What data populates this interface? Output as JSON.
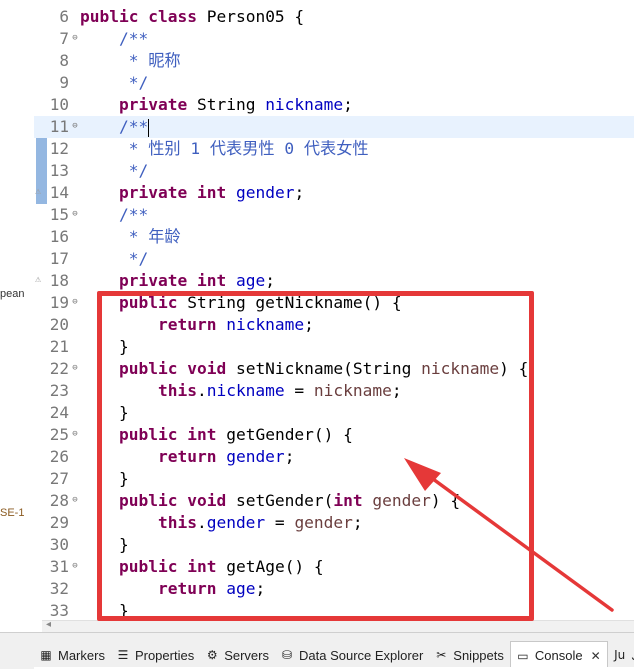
{
  "side_fragments": [
    "pean",
    "SE-1"
  ],
  "code": {
    "current_line": 11,
    "lines": [
      {
        "num": "6",
        "fold": "",
        "warn": false,
        "tokens": [
          [
            "kw",
            "public"
          ],
          [
            "pl",
            " "
          ],
          [
            "kw",
            "class"
          ],
          [
            "pl",
            " Person05 {"
          ]
        ]
      },
      {
        "num": "7",
        "fold": "⊖",
        "warn": false,
        "tokens": [
          [
            "pl",
            "    "
          ],
          [
            "cm",
            "/**"
          ]
        ]
      },
      {
        "num": "8",
        "fold": "",
        "warn": false,
        "tokens": [
          [
            "pl",
            "    "
          ],
          [
            "cm",
            " * 昵称"
          ]
        ]
      },
      {
        "num": "9",
        "fold": "",
        "warn": false,
        "tokens": [
          [
            "pl",
            "    "
          ],
          [
            "cm",
            " */"
          ]
        ]
      },
      {
        "num": "10",
        "fold": "",
        "warn": false,
        "tokens": [
          [
            "pl",
            "    "
          ],
          [
            "kw",
            "private"
          ],
          [
            "pl",
            " String "
          ],
          [
            "fd",
            "nickname"
          ],
          [
            "pl",
            ";"
          ]
        ]
      },
      {
        "num": "11",
        "fold": "⊖",
        "warn": false,
        "cursor": true,
        "tokens": [
          [
            "pl",
            "    "
          ],
          [
            "cm",
            "/**"
          ]
        ]
      },
      {
        "num": "12",
        "fold": "",
        "warn": false,
        "tokens": [
          [
            "pl",
            "    "
          ],
          [
            "cm",
            " * 性别 1 代表男性 0 代表女性"
          ]
        ]
      },
      {
        "num": "13",
        "fold": "",
        "warn": false,
        "tokens": [
          [
            "pl",
            "    "
          ],
          [
            "cm",
            " */"
          ]
        ]
      },
      {
        "num": "14",
        "fold": "",
        "warn": true,
        "tokens": [
          [
            "pl",
            "    "
          ],
          [
            "kw",
            "private"
          ],
          [
            "pl",
            " "
          ],
          [
            "kw",
            "int"
          ],
          [
            "pl",
            " "
          ],
          [
            "fd",
            "gender"
          ],
          [
            "pl",
            ";"
          ]
        ]
      },
      {
        "num": "15",
        "fold": "⊖",
        "warn": false,
        "tokens": [
          [
            "pl",
            "    "
          ],
          [
            "cm",
            "/**"
          ]
        ]
      },
      {
        "num": "16",
        "fold": "",
        "warn": false,
        "tokens": [
          [
            "pl",
            "    "
          ],
          [
            "cm",
            " * 年龄"
          ]
        ]
      },
      {
        "num": "17",
        "fold": "",
        "warn": false,
        "tokens": [
          [
            "pl",
            "    "
          ],
          [
            "cm",
            " */"
          ]
        ]
      },
      {
        "num": "18",
        "fold": "",
        "warn": true,
        "tokens": [
          [
            "pl",
            "    "
          ],
          [
            "kw",
            "private"
          ],
          [
            "pl",
            " "
          ],
          [
            "kw",
            "int"
          ],
          [
            "pl",
            " "
          ],
          [
            "fd",
            "age"
          ],
          [
            "pl",
            ";"
          ]
        ]
      },
      {
        "num": "19",
        "fold": "⊖",
        "warn": false,
        "tokens": [
          [
            "pl",
            "    "
          ],
          [
            "kw",
            "public"
          ],
          [
            "pl",
            " String getNickname() {"
          ]
        ]
      },
      {
        "num": "20",
        "fold": "",
        "warn": false,
        "tokens": [
          [
            "pl",
            "        "
          ],
          [
            "kw",
            "return"
          ],
          [
            "pl",
            " "
          ],
          [
            "fd",
            "nickname"
          ],
          [
            "pl",
            ";"
          ]
        ]
      },
      {
        "num": "21",
        "fold": "",
        "warn": false,
        "tokens": [
          [
            "pl",
            "    }"
          ]
        ]
      },
      {
        "num": "22",
        "fold": "⊖",
        "warn": false,
        "tokens": [
          [
            "pl",
            "    "
          ],
          [
            "kw",
            "public"
          ],
          [
            "pl",
            " "
          ],
          [
            "kw",
            "void"
          ],
          [
            "pl",
            " setNickname(String "
          ],
          [
            "pr",
            "nickname"
          ],
          [
            "pl",
            ") {"
          ]
        ]
      },
      {
        "num": "23",
        "fold": "",
        "warn": false,
        "tokens": [
          [
            "pl",
            "        "
          ],
          [
            "kw",
            "this"
          ],
          [
            "pl",
            "."
          ],
          [
            "fd",
            "nickname"
          ],
          [
            "pl",
            " = "
          ],
          [
            "pr",
            "nickname"
          ],
          [
            "pl",
            ";"
          ]
        ]
      },
      {
        "num": "24",
        "fold": "",
        "warn": false,
        "tokens": [
          [
            "pl",
            "    }"
          ]
        ]
      },
      {
        "num": "25",
        "fold": "⊖",
        "warn": false,
        "tokens": [
          [
            "pl",
            "    "
          ],
          [
            "kw",
            "public"
          ],
          [
            "pl",
            " "
          ],
          [
            "kw",
            "int"
          ],
          [
            "pl",
            " getGender() {"
          ]
        ]
      },
      {
        "num": "26",
        "fold": "",
        "warn": false,
        "tokens": [
          [
            "pl",
            "        "
          ],
          [
            "kw",
            "return"
          ],
          [
            "pl",
            " "
          ],
          [
            "fd",
            "gender"
          ],
          [
            "pl",
            ";"
          ]
        ]
      },
      {
        "num": "27",
        "fold": "",
        "warn": false,
        "tokens": [
          [
            "pl",
            "    }"
          ]
        ]
      },
      {
        "num": "28",
        "fold": "⊖",
        "warn": false,
        "tokens": [
          [
            "pl",
            "    "
          ],
          [
            "kw",
            "public"
          ],
          [
            "pl",
            " "
          ],
          [
            "kw",
            "void"
          ],
          [
            "pl",
            " setGender("
          ],
          [
            "kw",
            "int"
          ],
          [
            "pl",
            " "
          ],
          [
            "pr",
            "gender"
          ],
          [
            "pl",
            ") {"
          ]
        ]
      },
      {
        "num": "29",
        "fold": "",
        "warn": false,
        "tokens": [
          [
            "pl",
            "        "
          ],
          [
            "kw",
            "this"
          ],
          [
            "pl",
            "."
          ],
          [
            "fd",
            "gender"
          ],
          [
            "pl",
            " = "
          ],
          [
            "pr",
            "gender"
          ],
          [
            "pl",
            ";"
          ]
        ]
      },
      {
        "num": "30",
        "fold": "",
        "warn": false,
        "tokens": [
          [
            "pl",
            "    }"
          ]
        ]
      },
      {
        "num": "31",
        "fold": "⊖",
        "warn": false,
        "tokens": [
          [
            "pl",
            "    "
          ],
          [
            "kw",
            "public"
          ],
          [
            "pl",
            " "
          ],
          [
            "kw",
            "int"
          ],
          [
            "pl",
            " getAge() {"
          ]
        ]
      },
      {
        "num": "32",
        "fold": "",
        "warn": false,
        "tokens": [
          [
            "pl",
            "        "
          ],
          [
            "kw",
            "return"
          ],
          [
            "pl",
            " "
          ],
          [
            "fd",
            "age"
          ],
          [
            "pl",
            ";"
          ]
        ]
      },
      {
        "num": "33",
        "fold": "",
        "warn": false,
        "tokens": [
          [
            "pl",
            "    }"
          ]
        ]
      }
    ]
  },
  "colors": {
    "keyword": "#7f0055",
    "comment": "#3f5fbf",
    "field": "#0000c0",
    "parameter": "#6a3e3e",
    "annotation": "#e53838"
  },
  "bottom_tabs": [
    {
      "label": "Markers",
      "icon": "markers-icon",
      "glyph": "▦",
      "active": false
    },
    {
      "label": "Properties",
      "icon": "properties-icon",
      "glyph": "☰",
      "active": false
    },
    {
      "label": "Servers",
      "icon": "servers-icon",
      "glyph": "⚙",
      "active": false
    },
    {
      "label": "Data Source Explorer",
      "icon": "data-source-icon",
      "glyph": "⛁",
      "active": false
    },
    {
      "label": "Snippets",
      "icon": "snippets-icon",
      "glyph": "✂",
      "active": false
    },
    {
      "label": "Console",
      "icon": "console-icon",
      "glyph": "▭",
      "active": true,
      "close": "✕"
    },
    {
      "label": "JU",
      "icon": "junit-icon",
      "glyph": "Ju",
      "active": false
    }
  ]
}
